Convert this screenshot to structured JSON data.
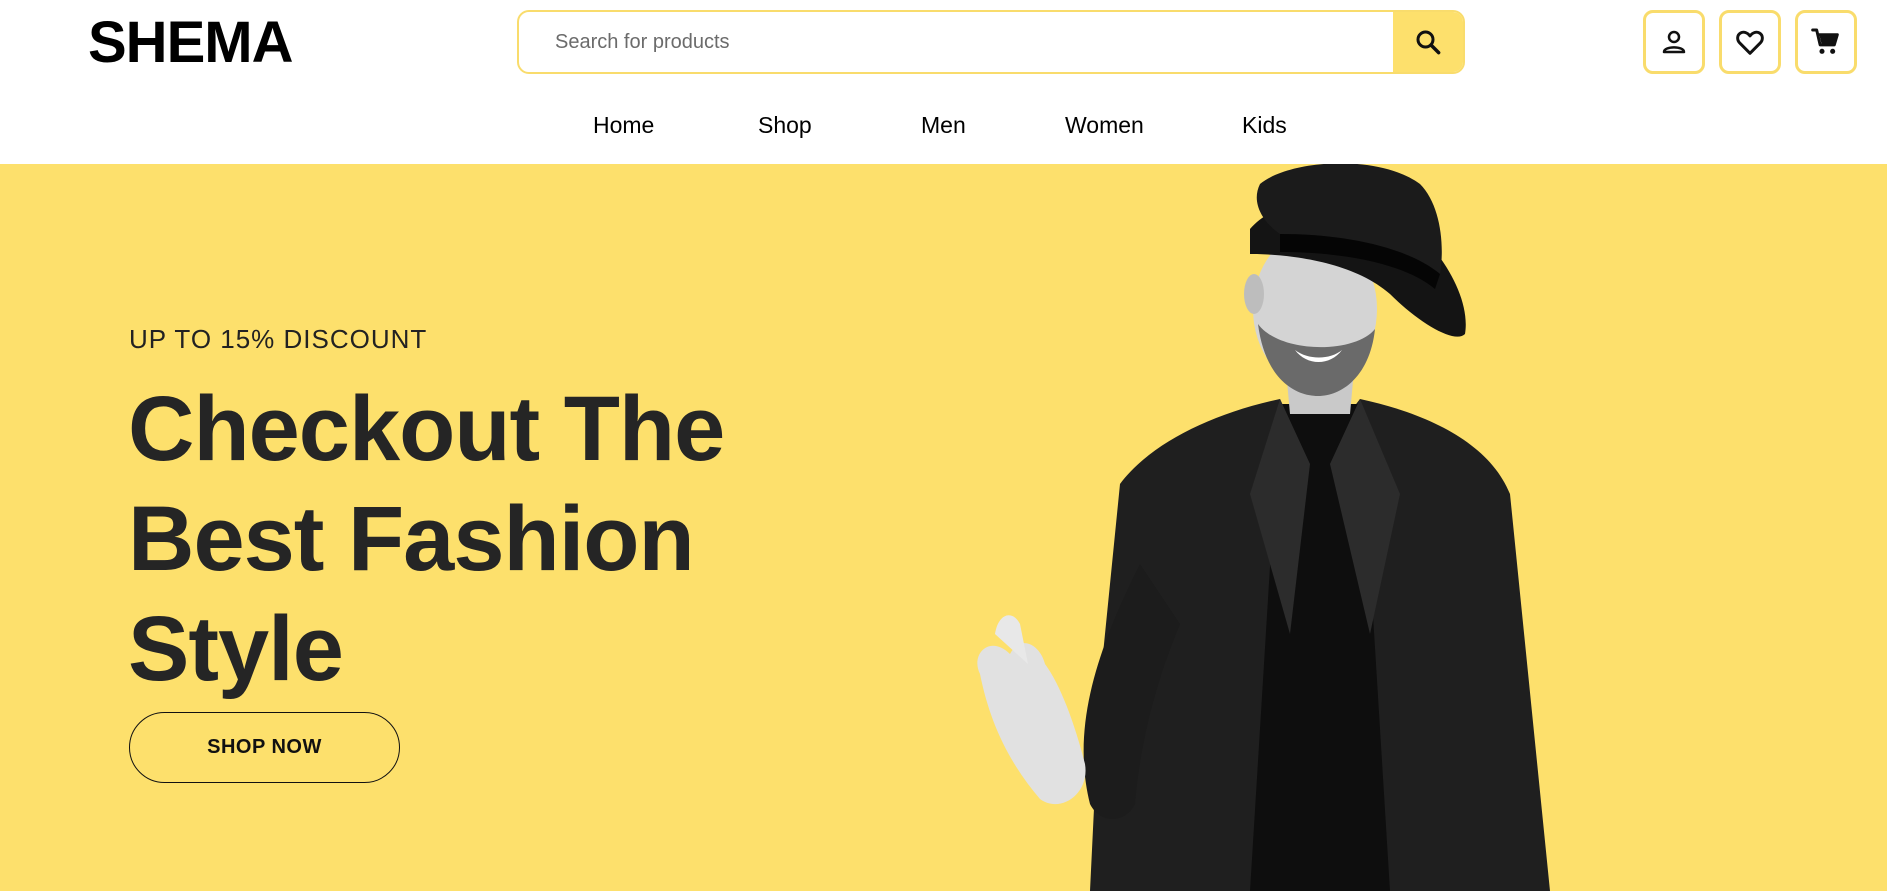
{
  "brand": {
    "name": "SHEMA"
  },
  "search": {
    "placeholder": "Search for products",
    "icon": "search-icon"
  },
  "header_actions": [
    {
      "name": "account",
      "icon": "user-icon"
    },
    {
      "name": "wishlist",
      "icon": "heart-icon"
    },
    {
      "name": "cart",
      "icon": "cart-icon"
    }
  ],
  "nav": {
    "items": [
      "Home",
      "Shop",
      "Men",
      "Women",
      "Kids"
    ]
  },
  "hero": {
    "eyebrow": "UP TO 15% DISCOUNT",
    "title_lines": [
      "Checkout The",
      "Best Fashion",
      "Style"
    ],
    "cta_label": "SHOP NOW",
    "image": "man-in-black-hat-photo"
  },
  "colors": {
    "accent": "#fde06c",
    "border": "#f9dc6c",
    "text_dark": "#252525",
    "black": "#000000",
    "white": "#ffffff"
  }
}
